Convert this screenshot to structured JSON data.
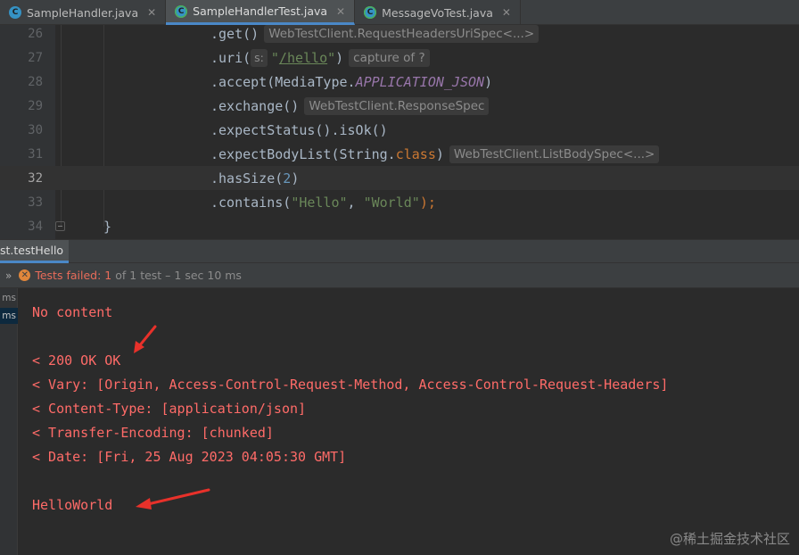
{
  "tabs": [
    {
      "label": "SampleHandler.java",
      "icon": "java-class-icon",
      "active": false
    },
    {
      "label": "SampleHandlerTest.java",
      "icon": "java-test-class-icon",
      "active": true
    },
    {
      "label": "MessageVoTest.java",
      "icon": "java-test-class-icon",
      "active": false
    }
  ],
  "editor": {
    "lines": [
      {
        "num": "26",
        "code": ".get()",
        "hint": "WebTestClient.RequestHeadersUriSpec<...>"
      },
      {
        "num": "27",
        "pre": ".uri(",
        "param_hint": "s:",
        "str": "\"/hello\"",
        "post": ")",
        "hint": "capture of ?"
      },
      {
        "num": "28",
        "pre": ".accept(MediaType.",
        "const": "APPLICATION_JSON",
        "post": ")"
      },
      {
        "num": "29",
        "code": ".exchange()",
        "hint": "WebTestClient.ResponseSpec"
      },
      {
        "num": "30",
        "code": ".expectStatus().isOk()"
      },
      {
        "num": "31",
        "pre": ".expectBodyList(String.",
        "kw": "class",
        "post": ")",
        "hint": "WebTestClient.ListBodySpec<...>"
      },
      {
        "num": "32",
        "pre": ".hasSize(",
        "num_lit": "2",
        "post": ")"
      },
      {
        "num": "33",
        "pre": ".contains(",
        "str1": "\"Hello\"",
        "mid": ", ",
        "str2": "\"World\"",
        "post": ");"
      },
      {
        "num": "34",
        "code": "}"
      }
    ]
  },
  "run": {
    "tab_label": "st.testHello",
    "status_label": "Tests failed:",
    "status_count": "1",
    "status_detail": "of 1 test – 1 sec 10 ms",
    "side_items": [
      "ms",
      "ms"
    ]
  },
  "console": {
    "lines": [
      "No content",
      "",
      "< 200 OK OK",
      "< Vary: [Origin, Access-Control-Request-Method, Access-Control-Request-Headers]",
      "< Content-Type: [application/json]",
      "< Transfer-Encoding: [chunked]",
      "< Date: [Fri, 25 Aug 2023 04:05:30 GMT]",
      "",
      "HelloWorld"
    ]
  },
  "watermark": "@稀土掘金技术社区",
  "colors": {
    "accent": "#4a88c7",
    "error_text": "#ff6b68",
    "annotation_arrow": "#e8312a"
  }
}
